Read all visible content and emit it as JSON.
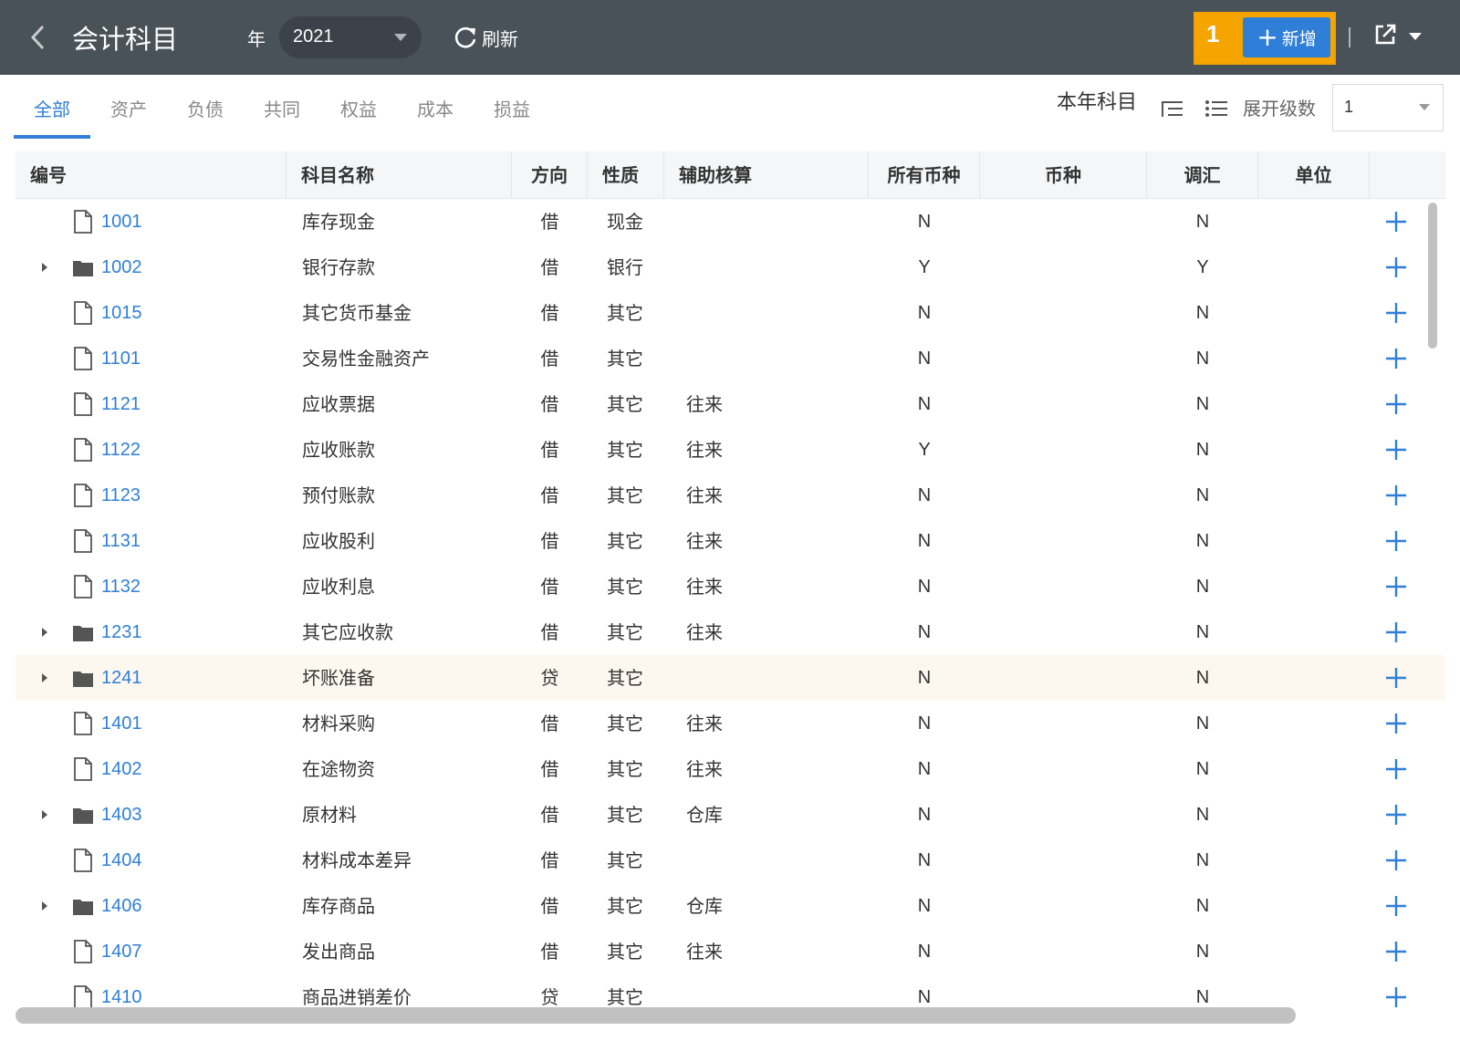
{
  "header": {
    "title": "会计科目",
    "year_label": "年",
    "year_value": "2021",
    "refresh_label": "刷新",
    "step_number": "1",
    "add_label": "新增"
  },
  "tabs": [
    {
      "label": "全部",
      "active": true
    },
    {
      "label": "资产"
    },
    {
      "label": "负债"
    },
    {
      "label": "共同"
    },
    {
      "label": "权益"
    },
    {
      "label": "成本"
    },
    {
      "label": "损益"
    }
  ],
  "toolbar": {
    "year_subjects_label": "本年科目",
    "expand_levels_label": "展开级数",
    "expand_levels_value": "1"
  },
  "columns": {
    "code": "编号",
    "name": "科目名称",
    "direction": "方向",
    "nature": "性质",
    "aux": "辅助核算",
    "all_currencies": "所有币种",
    "currency": "币种",
    "adjust": "调汇",
    "unit": "单位"
  },
  "rows": [
    {
      "code": "1001",
      "name": "库存现金",
      "dir": "借",
      "nature": "现金",
      "aux": "",
      "allcur": "N",
      "adj": "N",
      "folder": false
    },
    {
      "code": "1002",
      "name": "银行存款",
      "dir": "借",
      "nature": "银行",
      "aux": "",
      "allcur": "Y",
      "adj": "Y",
      "folder": true
    },
    {
      "code": "1015",
      "name": "其它货币基金",
      "dir": "借",
      "nature": "其它",
      "aux": "",
      "allcur": "N",
      "adj": "N",
      "folder": false
    },
    {
      "code": "1101",
      "name": "交易性金融资产",
      "dir": "借",
      "nature": "其它",
      "aux": "",
      "allcur": "N",
      "adj": "N",
      "folder": false
    },
    {
      "code": "1121",
      "name": "应收票据",
      "dir": "借",
      "nature": "其它",
      "aux": "往来",
      "allcur": "N",
      "adj": "N",
      "folder": false
    },
    {
      "code": "1122",
      "name": "应收账款",
      "dir": "借",
      "nature": "其它",
      "aux": "往来",
      "allcur": "Y",
      "adj": "N",
      "folder": false
    },
    {
      "code": "1123",
      "name": "预付账款",
      "dir": "借",
      "nature": "其它",
      "aux": "往来",
      "allcur": "N",
      "adj": "N",
      "folder": false
    },
    {
      "code": "1131",
      "name": "应收股利",
      "dir": "借",
      "nature": "其它",
      "aux": "往来",
      "allcur": "N",
      "adj": "N",
      "folder": false
    },
    {
      "code": "1132",
      "name": "应收利息",
      "dir": "借",
      "nature": "其它",
      "aux": "往来",
      "allcur": "N",
      "adj": "N",
      "folder": false
    },
    {
      "code": "1231",
      "name": "其它应收款",
      "dir": "借",
      "nature": "其它",
      "aux": "往来",
      "allcur": "N",
      "adj": "N",
      "folder": true
    },
    {
      "code": "1241",
      "name": "坏账准备",
      "dir": "贷",
      "nature": "其它",
      "aux": "",
      "allcur": "N",
      "adj": "N",
      "folder": true,
      "highlight": true
    },
    {
      "code": "1401",
      "name": "材料采购",
      "dir": "借",
      "nature": "其它",
      "aux": "往来",
      "allcur": "N",
      "adj": "N",
      "folder": false
    },
    {
      "code": "1402",
      "name": "在途物资",
      "dir": "借",
      "nature": "其它",
      "aux": "往来",
      "allcur": "N",
      "adj": "N",
      "folder": false
    },
    {
      "code": "1403",
      "name": "原材料",
      "dir": "借",
      "nature": "其它",
      "aux": "仓库",
      "allcur": "N",
      "adj": "N",
      "folder": true
    },
    {
      "code": "1404",
      "name": "材料成本差异",
      "dir": "借",
      "nature": "其它",
      "aux": "",
      "allcur": "N",
      "adj": "N",
      "folder": false
    },
    {
      "code": "1406",
      "name": "库存商品",
      "dir": "借",
      "nature": "其它",
      "aux": "仓库",
      "allcur": "N",
      "adj": "N",
      "folder": true
    },
    {
      "code": "1407",
      "name": "发出商品",
      "dir": "借",
      "nature": "其它",
      "aux": "往来",
      "allcur": "N",
      "adj": "N",
      "folder": false
    },
    {
      "code": "1410",
      "name": "商品进销差价",
      "dir": "贷",
      "nature": "其它",
      "aux": "",
      "allcur": "N",
      "adj": "N",
      "folder": false
    }
  ],
  "icons": {
    "back": "chevron-left-icon",
    "refresh": "refresh-icon",
    "add": "plus-icon",
    "export": "export-icon",
    "tree_view": "tree-list-icon",
    "list_view": "list-icon",
    "folder": "folder-icon",
    "file": "file-icon",
    "row_add": "plus-icon"
  },
  "colors": {
    "topbar": "#495159",
    "accent": "#2f7fd8",
    "highlight_box": "#f5a400",
    "row_highlight": "#fdf8ef"
  }
}
